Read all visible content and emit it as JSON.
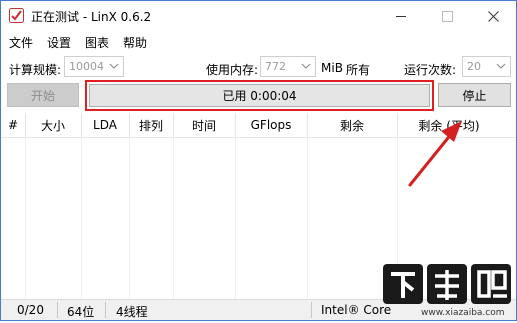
{
  "window": {
    "title": "正在测试 - LinX 0.6.2",
    "icon": "checkmark-app-icon",
    "controls": [
      "minimize-icon",
      "maximize-icon",
      "close-icon"
    ]
  },
  "menu": [
    "文件",
    "设置",
    "图表",
    "帮助"
  ],
  "settings": {
    "problem_size_label": "计算规模:",
    "problem_size_value": "10004",
    "memory_label": "使用内存:",
    "memory_value": "772",
    "memory_unit": "MiB",
    "all_label": "所有",
    "runs_label": "运行次数:",
    "runs_value": "20"
  },
  "actions": {
    "start_label": "开始",
    "elapsed_text": "已用 0:00:04",
    "stop_label": "停止"
  },
  "table": {
    "columns": [
      "#",
      "大小",
      "LDA",
      "排列",
      "时间",
      "GFlops",
      "剩余",
      "剩余 (平均)"
    ],
    "rows": []
  },
  "status": {
    "progress": "0/20",
    "bits": "64位",
    "threads": "4线程",
    "cpu": "Intel® Core"
  },
  "watermark": {
    "text": "下载吧",
    "url": "www.xiazaiba.com"
  },
  "colors": {
    "window_border": "#4a7bd4",
    "highlight_border": "#e02020",
    "annotation_arrow": "#d42020",
    "button_face": "#e1e1e1",
    "disabled_button_face": "#cccccc"
  }
}
